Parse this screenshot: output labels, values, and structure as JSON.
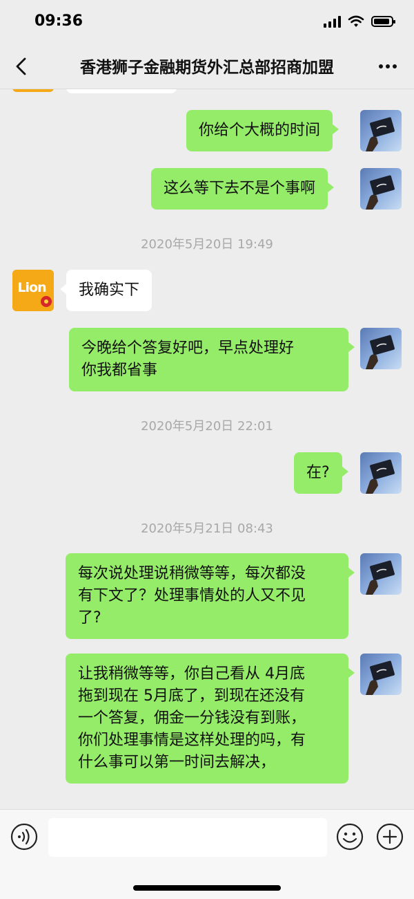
{
  "status_bar": {
    "time": "09:36"
  },
  "nav": {
    "title": "香港狮子金融期货外汇总部招商加盟"
  },
  "contact_avatar_text": "Lion",
  "timestamps": {
    "t1": "2020年5月20日 19:49",
    "t2": "2020年5月20日 22:01",
    "t3": "2020年5月21日 08:43"
  },
  "messages": {
    "m1": "你给个大概的时间",
    "m2": "这么等下去不是个事啊",
    "m3": "我确实下",
    "m4": "今晚给个答复好吧，早点处理好\n你我都省事",
    "m5": "在?",
    "m6": "每次说处理说稍微等等，每次都没\n有下文了？处理事情处的人又不见\n了?",
    "m7": "让我稍微等等，你自己看从 4月底\n拖到现在 5月底了，到现在还没有\n一个答复，佣金一分钱没有到账，\n你们处理事情是这样处理的吗，有\n什么事可以第一时间去解决，"
  },
  "input": {
    "placeholder": ""
  }
}
